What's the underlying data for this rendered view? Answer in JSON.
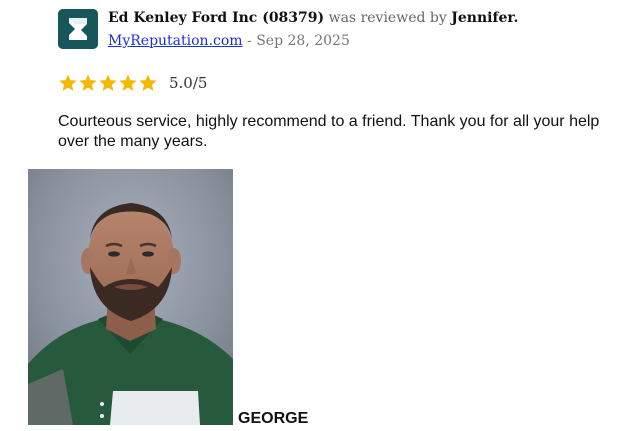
{
  "review": {
    "business_name": "Ed Kenley Ford Inc (08379)",
    "reviewed_by_text": " was reviewed by ",
    "reviewer_name": "Jennifer.",
    "source_link": "MyReputation.com",
    "date_separator": " - ",
    "date": "Sep 28, 2025",
    "rating": 5.0,
    "rating_text": "5.0/5",
    "star_color": "#f5b800",
    "body": "Courteous service, highly recommend to a friend. Thank you for all your help over the many years."
  },
  "logo": {
    "icon": "myreputation-logo-icon",
    "color": "#17565b"
  },
  "photo": {
    "icon": "employee-portrait-photo",
    "caption": "GEORGE"
  }
}
